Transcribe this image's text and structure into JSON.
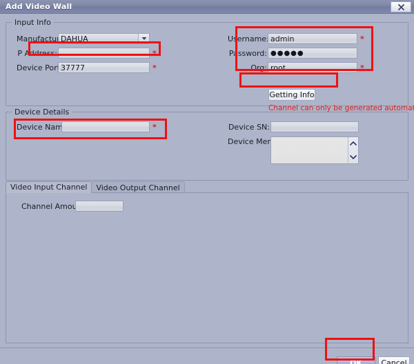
{
  "window": {
    "title": "Add Video Wall",
    "close_icon": "close-icon"
  },
  "input_info": {
    "legend": "Input Info",
    "manufacturer": {
      "label": "Manufacturer:",
      "value": "DAHUA",
      "arrow_icon": "chevron-down-icon"
    },
    "ip_address": {
      "label": "P Address:",
      "value": "",
      "required": "*"
    },
    "device_port": {
      "label": "Device Port:",
      "value": "37777",
      "required": "*"
    },
    "username": {
      "label": "Username:",
      "value": "admin",
      "required": "*"
    },
    "password": {
      "label": "Password:",
      "value": "●●●●●",
      "required": ""
    },
    "org": {
      "label": "Org:",
      "value": "root",
      "required": "*"
    },
    "getting_info_button": "Getting Info",
    "warning": "Channel can only be generated automatically"
  },
  "device_details": {
    "legend": "Device Details",
    "device_name": {
      "label": "Device Name:",
      "value": "",
      "required": "*"
    },
    "device_sn": {
      "label": "Device SN:",
      "value": ""
    },
    "device_memo": {
      "label": "Device Memo:",
      "value": "",
      "scroll_up_icon": "chevron-up-icon",
      "scroll_down_icon": "chevron-down-icon"
    }
  },
  "channel_tabs": {
    "tabs": [
      {
        "label": "Video Input Channel",
        "active": true
      },
      {
        "label": "Video Output Channel",
        "active": false
      }
    ],
    "channel_amount": {
      "label": "Channel Amount:",
      "value": ""
    }
  },
  "footer": {
    "ok_label": "OK",
    "cancel_label": "Cancel"
  },
  "colors": {
    "window_background": "#aeb4c9",
    "titlebar": "#7d85a6",
    "annotation_red": "#ee1111",
    "warning_red": "#e02020",
    "required_red": "#d5232a",
    "ok_button": "#b2b8da"
  }
}
